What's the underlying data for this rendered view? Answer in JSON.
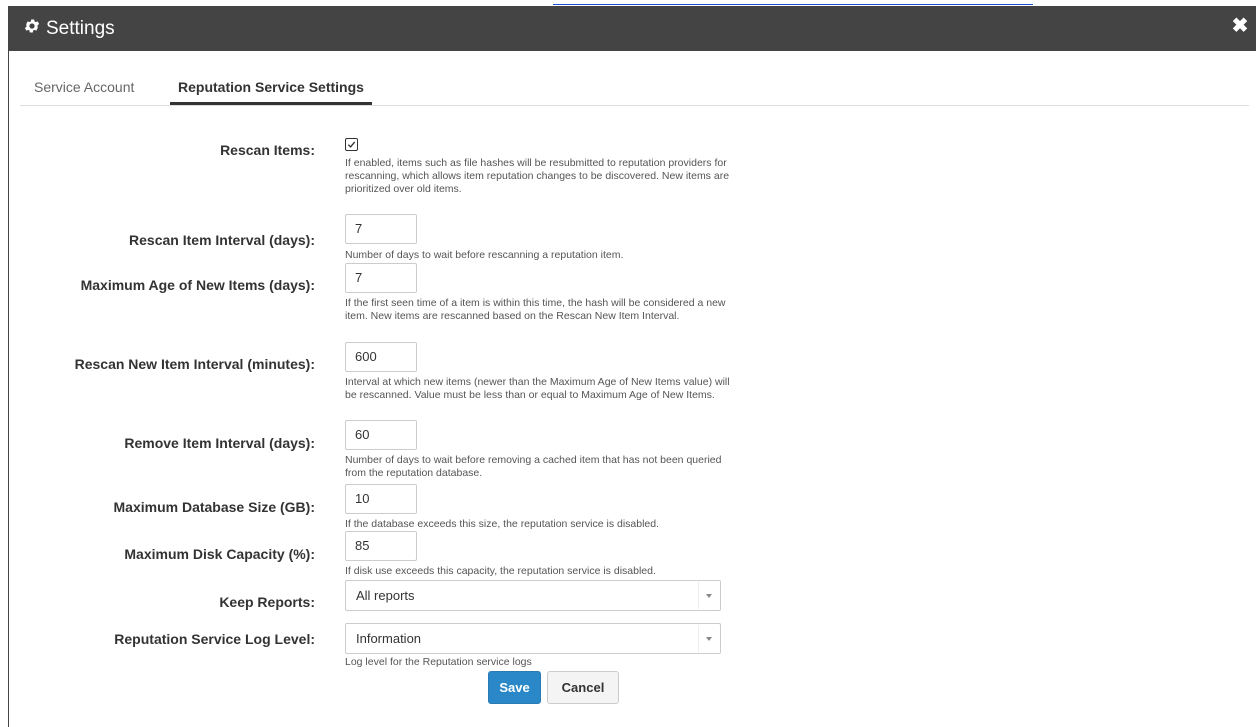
{
  "window": {
    "title": "Settings",
    "close_glyph": "✖",
    "icons": {
      "title": "gear-icon",
      "close": "close-icon"
    }
  },
  "tabs": [
    {
      "label": "Service Account",
      "active": false
    },
    {
      "label": "Reputation Service Settings",
      "active": true
    }
  ],
  "fields": {
    "rescan_items": {
      "label": "Rescan Items:",
      "checked": true,
      "help": "If enabled, items such as file hashes will be resubmitted to reputation providers for rescanning, which allows item reputation changes to be discovered. New items are prioritized over old items."
    },
    "rescan_interval": {
      "label": "Rescan Item Interval (days):",
      "value": "7",
      "help": "Number of days to wait before rescanning a reputation item."
    },
    "max_age": {
      "label": "Maximum Age of New Items (days):",
      "value": "7",
      "help": "If the first seen time of a item is within this time, the hash will be considered a new item. New items are rescanned based on the Rescan New Item Interval."
    },
    "rescan_new": {
      "label": "Rescan New Item Interval (minutes):",
      "value": "600",
      "help": "Interval at which new items (newer than the Maximum Age of New Items value) will be rescanned. Value must be less than or equal to Maximum Age of New Items."
    },
    "remove_interval": {
      "label": "Remove Item Interval (days):",
      "value": "60",
      "help": "Number of days to wait before removing a cached item that has not been queried from the reputation database."
    },
    "max_db_size": {
      "label": "Maximum Database Size (GB):",
      "value": "10",
      "help": "If the database exceeds this size, the reputation service is disabled."
    },
    "max_disk": {
      "label": "Maximum Disk Capacity (%):",
      "value": "85",
      "help": "If disk use exceeds this capacity, the reputation service is disabled."
    },
    "keep_reports": {
      "label": "Keep Reports:",
      "value": "All reports"
    },
    "log_level": {
      "label": "Reputation Service Log Level:",
      "value": "Information",
      "help": "Log level for the Reputation service logs"
    }
  },
  "buttons": {
    "save": "Save",
    "cancel": "Cancel"
  },
  "colors": {
    "titlebar": "#444444",
    "primary": "#2a88c8",
    "link": "#1a4fd8"
  }
}
